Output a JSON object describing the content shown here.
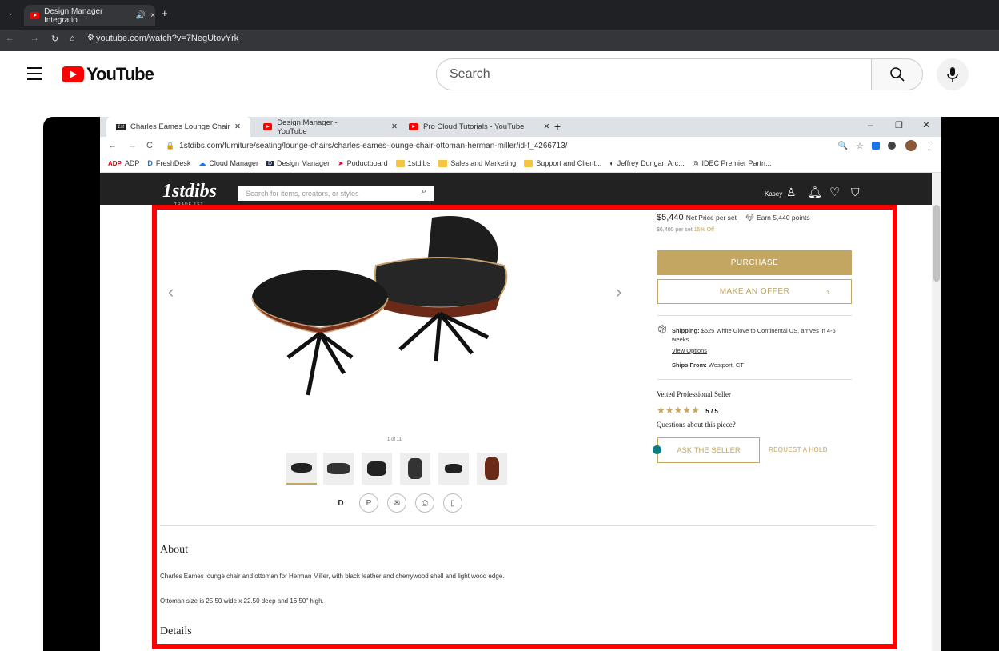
{
  "outer": {
    "tab_title": "Design Manager Integratio",
    "url": "youtube.com/watch?v=7NegUtovYrk",
    "new_tab": "+"
  },
  "youtube": {
    "wordmark": "YouTube",
    "search_placeholder": "Search"
  },
  "inner_tabs": [
    {
      "label": "Charles Eames Lounge Chair and",
      "favicon": "1st"
    },
    {
      "label": "Design Manager - YouTube"
    },
    {
      "label": "Pro Cloud Tutorials - YouTube"
    }
  ],
  "inner_url": "1stdibs.com/furniture/seating/lounge-chairs/charles-eames-lounge-chair-ottoman-herman-miller/id-f_4266713/",
  "bookmarks": [
    "ADP",
    "FreshDesk",
    "Cloud Manager",
    "Design Manager",
    "Poductboard",
    "1stdibs",
    "Sales and Marketing",
    "Support and Client...",
    "Jeffrey Dungan Arc...",
    "IDEC Premier Partn..."
  ],
  "site": {
    "logo": "1stdibs",
    "logo_sub": "TRADE 1ST",
    "search_placeholder": "Search for items, creators, or styles",
    "user": "Kasey"
  },
  "product": {
    "price": "$5,440",
    "price_note": "Net Price per set",
    "points": "Earn 5,440 points",
    "original_price": "$6,400",
    "original_note": "per set",
    "discount": "15% Off",
    "purchase": "PURCHASE",
    "offer": "MAKE AN OFFER",
    "shipping_label": "Shipping:",
    "shipping_text": "$525 White Glove to Continental US, arrives in 4-6 weeks.",
    "view_options": "View Options",
    "ships_from_label": "Ships From:",
    "ships_from": "Westport, CT",
    "seller": "Vetted Professional Seller",
    "rating": "5 / 5",
    "questions": "Questions about this piece?",
    "ask": "ASK THE SELLER",
    "hold": "REQUEST A HOLD",
    "image_counter": "1 of 11",
    "about_heading": "About",
    "about_1": "Charles Eames lounge chair and ottoman for Herman Miller, with black leather and cherrywood shell and light wood edge.",
    "about_2": "Ottoman size is 25.50 wide x 22.50 deep and 16.50\" high.",
    "details_heading": "Details"
  },
  "colors": {
    "accent": "#c2a661",
    "highlight": "#ff0000"
  }
}
